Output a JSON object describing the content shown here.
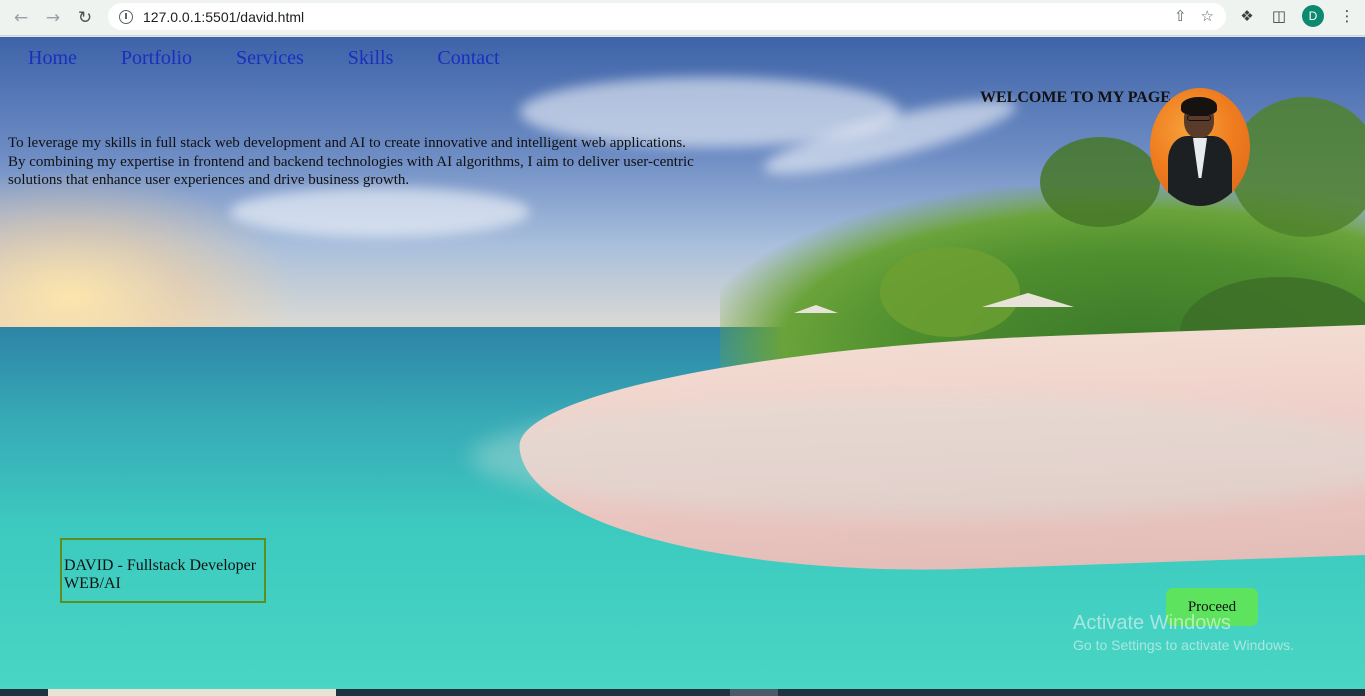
{
  "browser": {
    "url": "127.0.0.1:5501/david.html",
    "profile_initial": "D",
    "icons": [
      "back-icon",
      "forward-icon",
      "reload-icon",
      "info-icon",
      "share-icon",
      "star-icon",
      "extensions-icon",
      "side-panel-icon",
      "menu-icon"
    ]
  },
  "nav": {
    "items": [
      {
        "label": "Home"
      },
      {
        "label": "Portfolio"
      },
      {
        "label": "Services"
      },
      {
        "label": "Skills"
      },
      {
        "label": "Contact"
      }
    ],
    "color": "#1a2fbf"
  },
  "hero": {
    "welcome": "WELCOME TO MY PAGE",
    "mission_lines": [
      "To leverage my skills in full stack web development and AI to create innovative and intelligent web applications.",
      "By combining my expertise in frontend and backend technologies with AI algorithms, I aim to deliver user-centric",
      "solutions that enhance user experiences and drive business growth."
    ],
    "name_line1": "DAVID - Fullstack Developer",
    "name_line2": "WEB/AI",
    "proceed_label": "Proceed",
    "proceed_color": "#5ee35e",
    "box_border_color": "#5c8f1e"
  },
  "watermark": {
    "title": "Activate Windows",
    "subtitle": "Go to Settings to activate Windows."
  }
}
